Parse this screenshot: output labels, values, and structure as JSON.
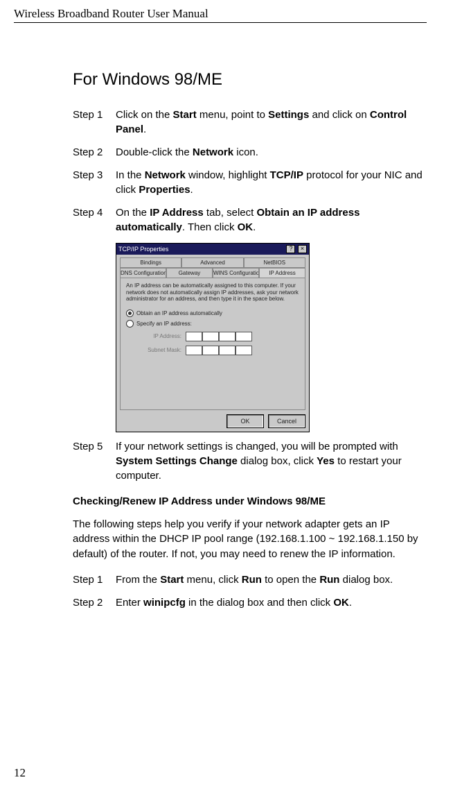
{
  "running_head": "Wireless Broadband Router User Manual",
  "section_heading": "For Windows 98/ME",
  "steps_a": [
    {
      "label": "Step 1",
      "html": "Click on the <b>Start</b> menu, point to <b>Settings</b> and click on <b>Control Panel</b>."
    },
    {
      "label": "Step 2",
      "html": "Double-click the <b>Network</b> icon."
    },
    {
      "label": "Step 3",
      "html": "In the <b>Network</b> window, highlight <b>TCP/IP</b> protocol for your NIC and click <b>Properties</b>."
    },
    {
      "label": "Step 4",
      "html": "On the <b>IP Address</b> tab, select <b>Obtain an IP address automatically</b>. Then click <b>OK</b>."
    }
  ],
  "step5": {
    "label": "Step 5",
    "html": "If your network settings is changed, you will be prompted with <b>System Settings Change</b> dialog box, click <b>Yes</b> to restart your computer."
  },
  "dialog": {
    "title": "TCP/IP Properties",
    "tabs_row1": [
      "Bindings",
      "Advanced",
      "NetBIOS"
    ],
    "tabs_row2": [
      "DNS Configuration",
      "Gateway",
      "WINS Configuration",
      "IP Address"
    ],
    "desc": "An IP address can be automatically assigned to this computer. If your network does not automatically assign IP addresses, ask your network administrator for an address, and then type it in the space below.",
    "radio_auto": "Obtain an IP address automatically",
    "radio_specify": "Specify an IP address:",
    "ip_label": "IP Address:",
    "subnet_label": "Subnet Mask:",
    "btn_ok": "OK",
    "btn_cancel": "Cancel",
    "help_icon": "?",
    "close_icon": "×"
  },
  "subheading": "Checking/Renew IP Address under Windows 98/ME",
  "para": "The following steps help you verify if your network adapter gets an IP address within the DHCP IP pool range (192.168.1.100 ~ 192.168.1.150 by default) of the router. If not, you may need to renew the IP information.",
  "steps_b": [
    {
      "label": "Step 1",
      "html": "From the <b>Start</b> menu, click <b>Run</b> to open the <b>Run</b> dialog box."
    },
    {
      "label": "Step 2",
      "html": "Enter <b>winipcfg</b> in the dialog box and then click <b>OK</b>."
    }
  ],
  "page_number": "12"
}
